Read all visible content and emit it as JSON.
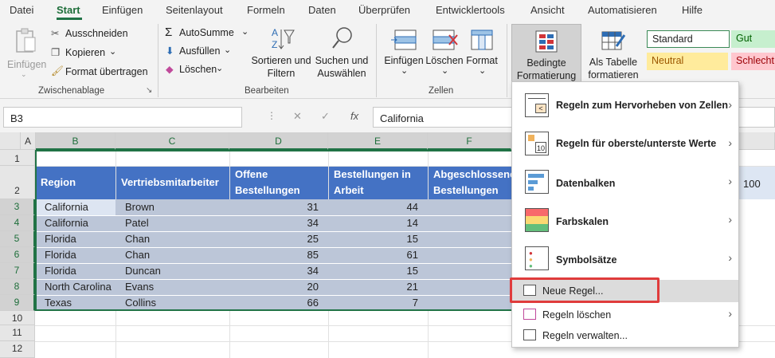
{
  "menu_tabs": [
    "Datei",
    "Start",
    "Einfügen",
    "Seitenlayout",
    "Formeln",
    "Daten",
    "Überprüfen",
    "Entwicklertools",
    "Ansicht",
    "Automatisieren",
    "Hilfe"
  ],
  "clipboard": {
    "paste": "Einfügen",
    "cut": "Ausschneiden",
    "copy": "Kopieren",
    "format_painter": "Format übertragen",
    "group": "Zwischenablage"
  },
  "editing": {
    "autosum": "AutoSumme",
    "fill": "Ausfüllen",
    "clear": "Löschen",
    "sort": "Sortieren und Filtern",
    "find": "Suchen und Auswählen",
    "group": "Bearbeiten"
  },
  "cells": {
    "insert": "Einfügen",
    "delete": "Löschen",
    "format": "Format",
    "group": "Zellen"
  },
  "styles": {
    "conditional": "Bedingte Formatierung",
    "as_table": "Als Tabelle formatieren",
    "standard": "Standard",
    "good": "Gut",
    "neutral": "Neutral",
    "bad": "Schlecht"
  },
  "formula_bar": {
    "name_box": "B3",
    "cancel": "✕",
    "confirm": "✓",
    "fx": "fx",
    "value": "California"
  },
  "columns": [
    "A",
    "B",
    "C",
    "D",
    "E",
    "F"
  ],
  "rows": [
    "1",
    "2",
    "3",
    "4",
    "5",
    "6",
    "7",
    "8",
    "9",
    "10",
    "11",
    "12"
  ],
  "table": {
    "headers": [
      "Region",
      "Vertriebsmitarbeiter",
      "Offene Bestellungen",
      "Bestellungen in Arbeit",
      "Abgeschlossene Bestellungen"
    ],
    "data": [
      [
        "California",
        "Brown",
        "31",
        "44"
      ],
      [
        "California",
        "Patel",
        "34",
        "14"
      ],
      [
        "Florida",
        "Chan",
        "25",
        "15"
      ],
      [
        "Florida",
        "Chan",
        "85",
        "61"
      ],
      [
        "Florida",
        "Duncan",
        "34",
        "15"
      ],
      [
        "North Carolina",
        "Evans",
        "20",
        "21"
      ],
      [
        "Texas",
        "Collins",
        "66",
        "7"
      ]
    ],
    "side_value": "100"
  },
  "dropdown": {
    "items": [
      "Regeln zum Hervorheben von Zellen",
      "Regeln für oberste/unterste Werte",
      "Datenbalken",
      "Farbskalen",
      "Symbolsätze"
    ],
    "new_rule": "Neue Regel...",
    "clear_rules": "Regeln löschen",
    "manage_rules": "Regeln verwalten..."
  },
  "colors": {
    "accent": "#217346",
    "header_fill": "#4472c4",
    "selection": "#bcc6d8",
    "highlight_box": "#e03c3c"
  }
}
